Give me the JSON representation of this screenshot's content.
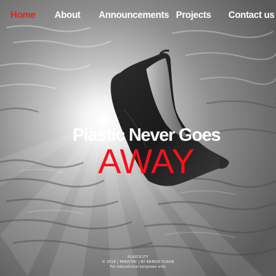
{
  "nav": {
    "items": [
      {
        "label": "Home",
        "active": true
      },
      {
        "label": "About",
        "active": false
      },
      {
        "label": "Announcements",
        "active": false
      },
      {
        "label": "Projects",
        "active": false
      },
      {
        "label": "Contact us",
        "active": false
      }
    ]
  },
  "hero": {
    "line1": "Plastic Never Goes",
    "line2": "AWAY"
  },
  "footer": {
    "site": "PLASTICITY",
    "copyright": "© 2018 | MINISTRY | BY RAMON YUSON",
    "note": "For educational purposes only"
  },
  "colors": {
    "accent": "#e8231f",
    "hero_accent": "#f5111b",
    "text": "#ffffff"
  },
  "image": {
    "subject": "plastic-bag-underwater-icon"
  }
}
